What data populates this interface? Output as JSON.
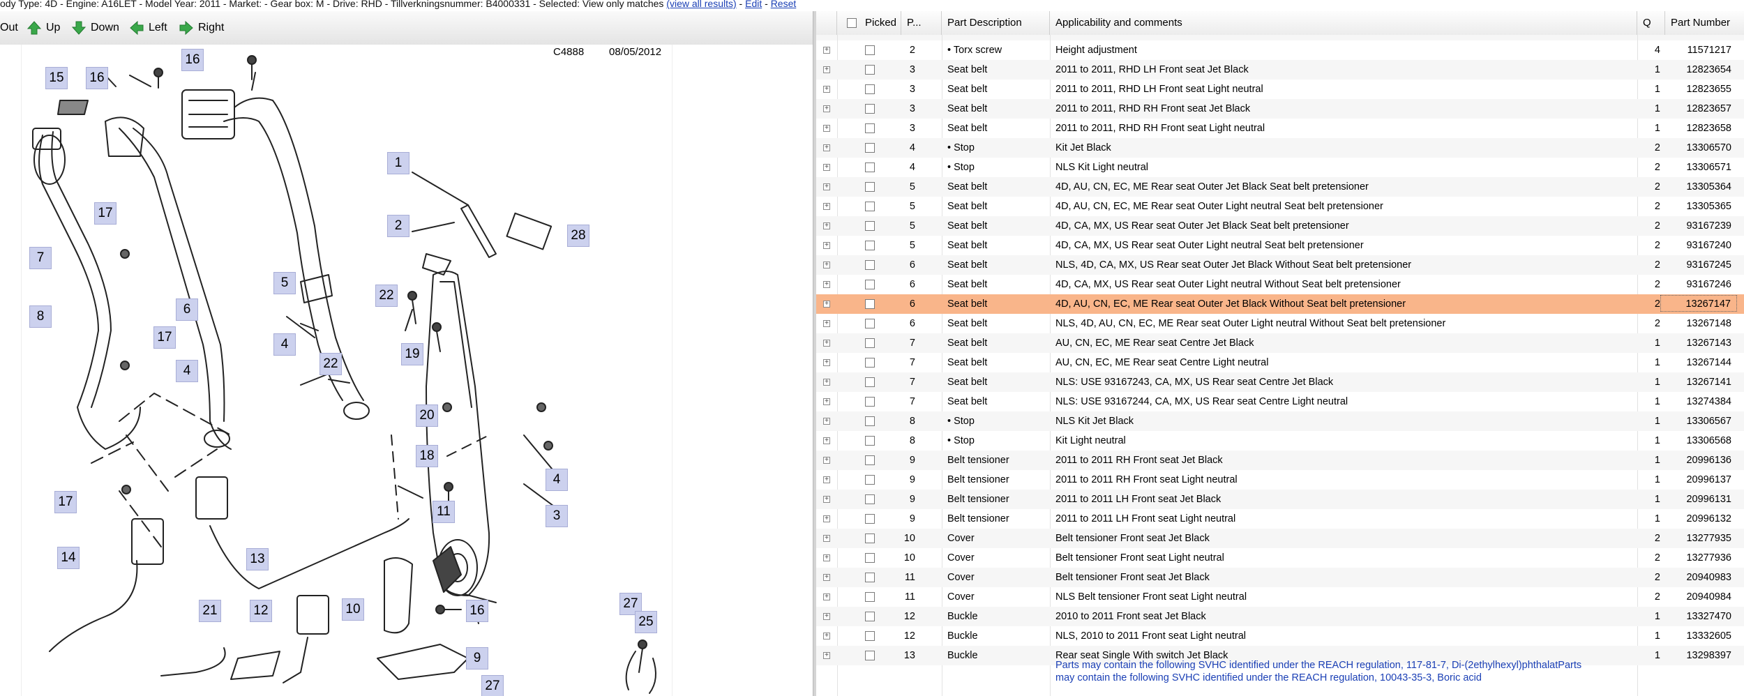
{
  "top_info": {
    "text": "ody Type: 4D - Engine: A16LET - Model Year: 2011 - Market: - Gear box: M - Drive: RHD - Tillverkningsnummer: B4000331 - Selected: View only matches",
    "link1": "(view all results)",
    "link2": "Edit",
    "link3": "Reset"
  },
  "toolbar": {
    "out": "Out",
    "up": "Up",
    "down": "Down",
    "left": "Left",
    "right": "Right"
  },
  "diagram": {
    "code": "C4888",
    "date": "08/05/2012",
    "callouts": [
      "16",
      "15",
      "16",
      "17",
      "1",
      "2",
      "28",
      "7",
      "8",
      "6",
      "5",
      "22",
      "17",
      "4",
      "4",
      "22",
      "19",
      "20",
      "18",
      "4",
      "3",
      "17",
      "11",
      "14",
      "13",
      "21",
      "12",
      "10",
      "16",
      "9",
      "27",
      "25",
      "27"
    ]
  },
  "table": {
    "headers": {
      "picked": "Picked",
      "pos": "P...",
      "desc": "Part Description",
      "comments": "Applicability and comments",
      "qty": "Q",
      "part": "Part Number"
    },
    "rows": [
      {
        "pos": "2",
        "desc": "• Torx screw",
        "comment": "Height adjustment",
        "qty": "4",
        "pn": "11571217"
      },
      {
        "pos": "3",
        "desc": "Seat belt",
        "comment": "2011 to 2011, RHD LH Front seat Jet Black",
        "qty": "1",
        "pn": "12823654"
      },
      {
        "pos": "3",
        "desc": "Seat belt",
        "comment": "2011 to 2011, RHD LH Front seat Light neutral",
        "qty": "1",
        "pn": "12823655"
      },
      {
        "pos": "3",
        "desc": "Seat belt",
        "comment": "2011 to 2011, RHD RH Front seat Jet Black",
        "qty": "1",
        "pn": "12823657"
      },
      {
        "pos": "3",
        "desc": "Seat belt",
        "comment": "2011 to 2011, RHD RH Front seat Light neutral",
        "qty": "1",
        "pn": "12823658"
      },
      {
        "pos": "4",
        "desc": "• Stop",
        "comment": "Kit Jet Black",
        "qty": "2",
        "pn": "13306570"
      },
      {
        "pos": "4",
        "desc": "• Stop",
        "comment": "NLS Kit Light neutral",
        "qty": "2",
        "pn": "13306571"
      },
      {
        "pos": "5",
        "desc": "Seat belt",
        "comment": "4D, AU, CN, EC, ME Rear seat Outer Jet Black Seat belt pretensioner",
        "qty": "2",
        "pn": "13305364"
      },
      {
        "pos": "5",
        "desc": "Seat belt",
        "comment": "4D, AU, CN, EC, ME Rear seat Outer Light neutral Seat belt pretensioner",
        "qty": "2",
        "pn": "13305365"
      },
      {
        "pos": "5",
        "desc": "Seat belt",
        "comment": "4D, CA, MX, US Rear seat Outer Jet Black Seat belt pretensioner",
        "qty": "2",
        "pn": "93167239"
      },
      {
        "pos": "5",
        "desc": "Seat belt",
        "comment": "4D, CA, MX, US Rear seat Outer Light neutral Seat belt pretensioner",
        "qty": "2",
        "pn": "93167240"
      },
      {
        "pos": "6",
        "desc": "Seat belt",
        "comment": "NLS, 4D, CA, MX, US Rear seat Outer Jet Black Without Seat belt pretensioner",
        "qty": "2",
        "pn": "93167245"
      },
      {
        "pos": "6",
        "desc": "Seat belt",
        "comment": "4D, CA, MX, US Rear seat Outer Light neutral Without Seat belt pretensioner",
        "qty": "2",
        "pn": "93167246"
      },
      {
        "pos": "6",
        "desc": "Seat belt",
        "comment": "4D, AU, CN, EC, ME Rear seat Outer Jet Black Without Seat belt pretensioner",
        "qty": "2",
        "pn": "13267147",
        "selected": true
      },
      {
        "pos": "6",
        "desc": "Seat belt",
        "comment": "NLS, 4D, AU, CN, EC, ME Rear seat Outer Light neutral Without Seat belt pretensioner",
        "qty": "2",
        "pn": "13267148"
      },
      {
        "pos": "7",
        "desc": "Seat belt",
        "comment": "AU, CN, EC, ME Rear seat Centre Jet Black",
        "qty": "1",
        "pn": "13267143"
      },
      {
        "pos": "7",
        "desc": "Seat belt",
        "comment": "AU, CN, EC, ME Rear seat Centre Light neutral",
        "qty": "1",
        "pn": "13267144"
      },
      {
        "pos": "7",
        "desc": "Seat belt",
        "comment": "NLS: USE 93167243, CA, MX, US Rear seat Centre Jet Black",
        "qty": "1",
        "pn": "13267141"
      },
      {
        "pos": "7",
        "desc": "Seat belt",
        "comment": "NLS: USE 93167244, CA, MX, US Rear seat Centre Light neutral",
        "qty": "1",
        "pn": "13274384"
      },
      {
        "pos": "8",
        "desc": "• Stop",
        "comment": "NLS Kit Jet Black",
        "qty": "1",
        "pn": "13306567"
      },
      {
        "pos": "8",
        "desc": "• Stop",
        "comment": "Kit Light neutral",
        "qty": "1",
        "pn": "13306568"
      },
      {
        "pos": "9",
        "desc": "Belt tensioner",
        "comment": "2011 to 2011 RH Front seat Jet Black",
        "qty": "1",
        "pn": "20996136"
      },
      {
        "pos": "9",
        "desc": "Belt tensioner",
        "comment": "2011 to 2011 RH Front seat Light neutral",
        "qty": "1",
        "pn": "20996137"
      },
      {
        "pos": "9",
        "desc": "Belt tensioner",
        "comment": "2011 to 2011 LH Front seat Jet Black",
        "qty": "1",
        "pn": "20996131"
      },
      {
        "pos": "9",
        "desc": "Belt tensioner",
        "comment": "2011 to 2011 LH Front seat Light neutral",
        "qty": "1",
        "pn": "20996132"
      },
      {
        "pos": "10",
        "desc": "Cover",
        "comment": "Belt tensioner Front seat Jet Black",
        "qty": "2",
        "pn": "13277935"
      },
      {
        "pos": "10",
        "desc": "Cover",
        "comment": "Belt tensioner Front seat Light neutral",
        "qty": "2",
        "pn": "13277936"
      },
      {
        "pos": "11",
        "desc": "Cover",
        "comment": "Belt tensioner Front seat Jet Black",
        "qty": "2",
        "pn": "20940983"
      },
      {
        "pos": "11",
        "desc": "Cover",
        "comment": "NLS Belt tensioner Front seat Light neutral",
        "qty": "2",
        "pn": "20940984"
      },
      {
        "pos": "12",
        "desc": "Buckle",
        "comment": "2010 to 2011 Front seat Jet Black",
        "qty": "1",
        "pn": "13327470"
      },
      {
        "pos": "12",
        "desc": "Buckle",
        "comment": "NLS, 2010 to 2011 Front seat Light neutral",
        "qty": "1",
        "pn": "13332605"
      },
      {
        "pos": "13",
        "desc": "Buckle",
        "comment": "Rear seat Single With switch Jet Black",
        "qty": "1",
        "pn": "13298397"
      }
    ],
    "note1": "Parts may contain the following SVHC identified under the REACH regulation, 117-81-7, Di-(2ethylhexyl)phthalatParts",
    "note2": "may contain the following SVHC identified under the REACH regulation, 10043-35-3, Boric acid"
  },
  "colors": {
    "selected_row": "#f9b58a",
    "callout": "#ccd1ee",
    "up_arrow": "#3aa84a"
  }
}
